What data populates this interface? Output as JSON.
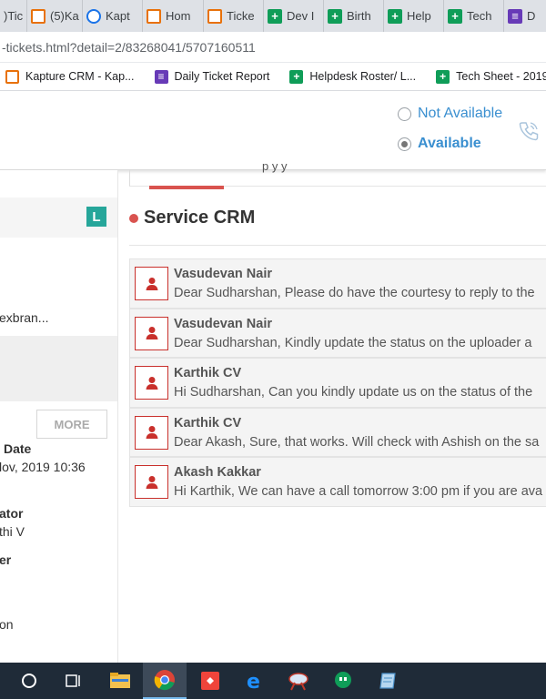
{
  "browser": {
    "tabs": [
      {
        "label": ")Tic",
        "favicon": "kapture-icon"
      },
      {
        "label": "(5)Ka",
        "favicon": "kapture-icon"
      },
      {
        "label": "Kapt",
        "favicon": "kapture-blue-icon"
      },
      {
        "label": "Hom",
        "favicon": "kapture-icon"
      },
      {
        "label": "Ticke",
        "favicon": "kapture-icon"
      },
      {
        "label": "Dev I",
        "favicon": "sheets-icon"
      },
      {
        "label": "Birth",
        "favicon": "sheets-icon"
      },
      {
        "label": "Help",
        "favicon": "sheets-icon"
      },
      {
        "label": "Tech",
        "favicon": "sheets-icon"
      },
      {
        "label": "D",
        "favicon": "forms-icon"
      }
    ],
    "url": "-tickets.html?detail=2/83268041/5707160511",
    "bookmarks": [
      {
        "label": "Kapture CRM - Kap...",
        "favicon": "kapture-icon"
      },
      {
        "label": "Daily Ticket Report",
        "favicon": "forms-icon"
      },
      {
        "label": "Helpdesk Roster/ L...",
        "favicon": "sheets-icon"
      },
      {
        "label": "Tech Sheet - 2019 -...",
        "favicon": "sheets-icon"
      }
    ]
  },
  "header": {
    "status_options": [
      {
        "label": "Not Available",
        "selected": false
      },
      {
        "label": "Available",
        "selected": true
      }
    ]
  },
  "left_panel": {
    "badge": "L",
    "truncated_email": "exbran...",
    "more_button": "MORE",
    "fields": {
      "date_label": "Date",
      "date_value": "lov, 2019 10:36",
      "creator_label": "ator",
      "creator_value": "thi V",
      "other_label": "er",
      "other_value": "on"
    }
  },
  "main": {
    "section_title": "Service CRM",
    "partial_tab_text": "p    y     y",
    "messages": [
      {
        "name": "Vasudevan Nair",
        "snippet": "Dear Sudharshan, Please do have the courtesy to reply to the"
      },
      {
        "name": "Vasudevan Nair",
        "snippet": "Dear Sudharshan,  Kindly update the status on the uploader a"
      },
      {
        "name": "Karthik CV",
        "snippet": "Hi Sudharshan, Can you kindly update us on the status of the"
      },
      {
        "name": "Karthik CV",
        "snippet": "Dear Akash, Sure, that works. Will check with Ashish on the sa"
      },
      {
        "name": "Akash Kakkar",
        "snippet": "Hi Karthik, We can have a call tomorrow 3:00 pm if you are ava"
      }
    ]
  },
  "taskbar": {
    "items": [
      "cortana-icon",
      "task-view-icon",
      "file-explorer-icon",
      "chrome-icon",
      "anydesk-icon",
      "edge-icon",
      "snipping-icon",
      "hangouts-icon",
      "notepad-icon"
    ],
    "active": "chrome-icon"
  },
  "colors": {
    "accent_red": "#d9534f",
    "link_blue": "#3a8fd0",
    "badge_teal": "#26a69a",
    "taskbar": "#1f2b38"
  }
}
